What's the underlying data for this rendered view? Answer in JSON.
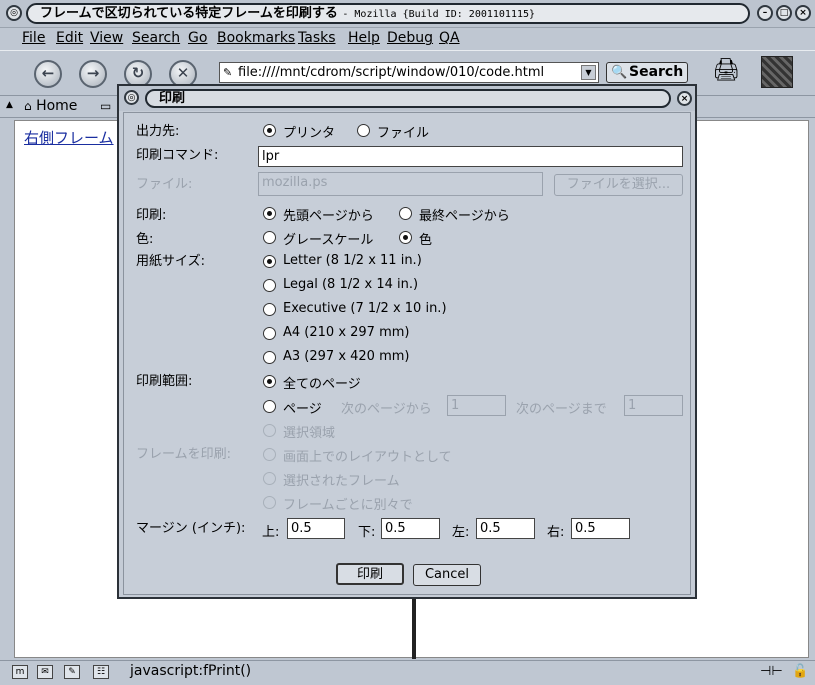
{
  "window": {
    "title": "フレームで区切られている特定フレームを印刷する",
    "title_suffix": "- Mozilla {Build ID: 2001101115}"
  },
  "menu": [
    "File",
    "Edit",
    "View",
    "Search",
    "Go",
    "Bookmarks",
    "Tasks",
    "Help",
    "Debug",
    "QA"
  ],
  "nav": {
    "url": "file:////mnt/cdrom/script/window/010/code.html",
    "search_label": "Search",
    "home_label": "Home"
  },
  "content": {
    "link_text": "右側フレーム"
  },
  "status": {
    "text": "javascript:fPrint()"
  },
  "dialog": {
    "title": "印刷",
    "dest_label": "出力先:",
    "dest_printer": "プリンタ",
    "dest_file": "ファイル",
    "command_label": "印刷コマンド:",
    "command_value": "lpr",
    "file_label": "ファイル:",
    "file_value": "mozilla.ps",
    "file_choose": "ファイルを選択...",
    "print_label": "印刷:",
    "order_first": "先頭ページから",
    "order_last": "最終ページから",
    "color_label": "色:",
    "color_gray": "グレースケール",
    "color_color": "色",
    "paper_label": "用紙サイズ:",
    "paper_sizes": [
      "Letter (8 1/2 x 11 in.)",
      "Legal (8 1/2 x 14 in.)",
      "Executive (7 1/2 x 10 in.)",
      "A4 (210 x 297 mm)",
      "A3 (297 x 420 mm)"
    ],
    "range_label": "印刷範囲:",
    "range_all": "全てのページ",
    "range_pages": "ページ",
    "range_from": "次のページから",
    "range_from_value": "1",
    "range_to": "次のページまで",
    "range_to_value": "1",
    "range_selection": "選択領域",
    "frames_label": "フレームを印刷:",
    "frame_layout": "画面上でのレイアウトとして",
    "frame_selected": "選択されたフレーム",
    "frame_each": "フレームごとに別々で",
    "margin_label": "マージン (インチ):",
    "margin_top_label": "上:",
    "margin_top": "0.5",
    "margin_bottom_label": "下:",
    "margin_bottom": "0.5",
    "margin_left_label": "左:",
    "margin_left": "0.5",
    "margin_right_label": "右:",
    "margin_right": "0.5",
    "print_button": "印刷",
    "cancel_button": "Cancel"
  }
}
